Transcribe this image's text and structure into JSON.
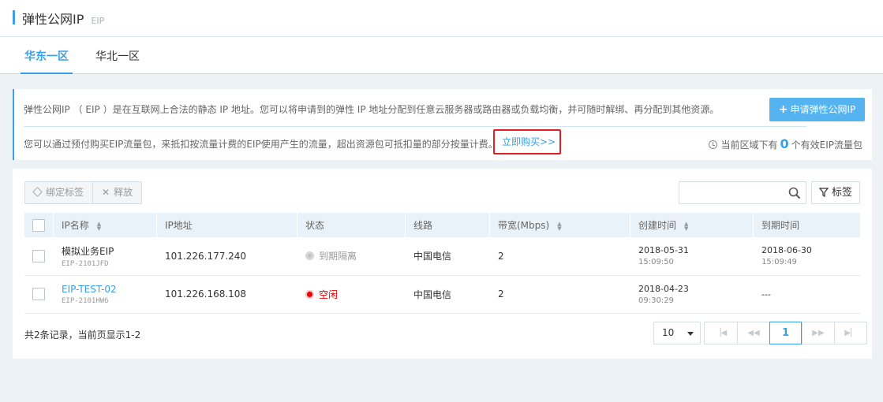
{
  "header": {
    "title": "弹性公网IP",
    "subtitle": "EIP"
  },
  "tabs": [
    {
      "label": "华东一区"
    },
    {
      "label": "华北一区"
    }
  ],
  "info": {
    "description": "弹性公网IP （ EIP ）是在互联网上合法的静态 IP 地址。您可以将申请到的弹性 IP 地址分配到任意云服务器或路由器或负载均衡，并可随时解绑、再分配到其他资源。",
    "apply_button": "申请弹性公网IP",
    "package_text": "您可以通过预付购买EIP流量包，来抵扣按流量计费的EIP使用产生的流量，超出资源包可抵扣量的部分按量计费。",
    "buy_link": "立即购买>>",
    "quota_prefix": "当前区域下有",
    "quota_count": "0",
    "quota_suffix": "个有效EIP流量包"
  },
  "toolbar": {
    "bind_tag": "绑定标签",
    "release": "释放",
    "search_placeholder": "",
    "tag_button": "标签"
  },
  "table": {
    "columns": [
      "IP名称",
      "IP地址",
      "状态",
      "线路",
      "带宽(Mbps)",
      "创建时间",
      "到期时间"
    ],
    "rows": [
      {
        "name": "模拟业务EIP",
        "id": "EIP-2101JFD",
        "ip": "101.226.177.240",
        "status": "到期隔离",
        "line": "中国电信",
        "bandwidth": "2",
        "created_date": "2018-05-31",
        "created_time": "15:09:50",
        "expire_date": "2018-06-30",
        "expire_time": "15:09:49"
      },
      {
        "name": "EIP-TEST-02",
        "id": "EIP-2101HW6",
        "ip": "101.226.168.108",
        "status": "空闲",
        "line": "中国电信",
        "bandwidth": "2",
        "created_date": "2018-04-23",
        "created_time": "09:30:29",
        "expire_date": "---",
        "expire_time": ""
      }
    ]
  },
  "footer": {
    "summary": "共2条记录，当前页显示1-2",
    "page_size": "10",
    "current_page": "1"
  },
  "colors": {
    "accent": "#3a9fe6",
    "status_idle": "#e00000",
    "status_expired": "#999999",
    "highlight_box": "#e02020"
  }
}
